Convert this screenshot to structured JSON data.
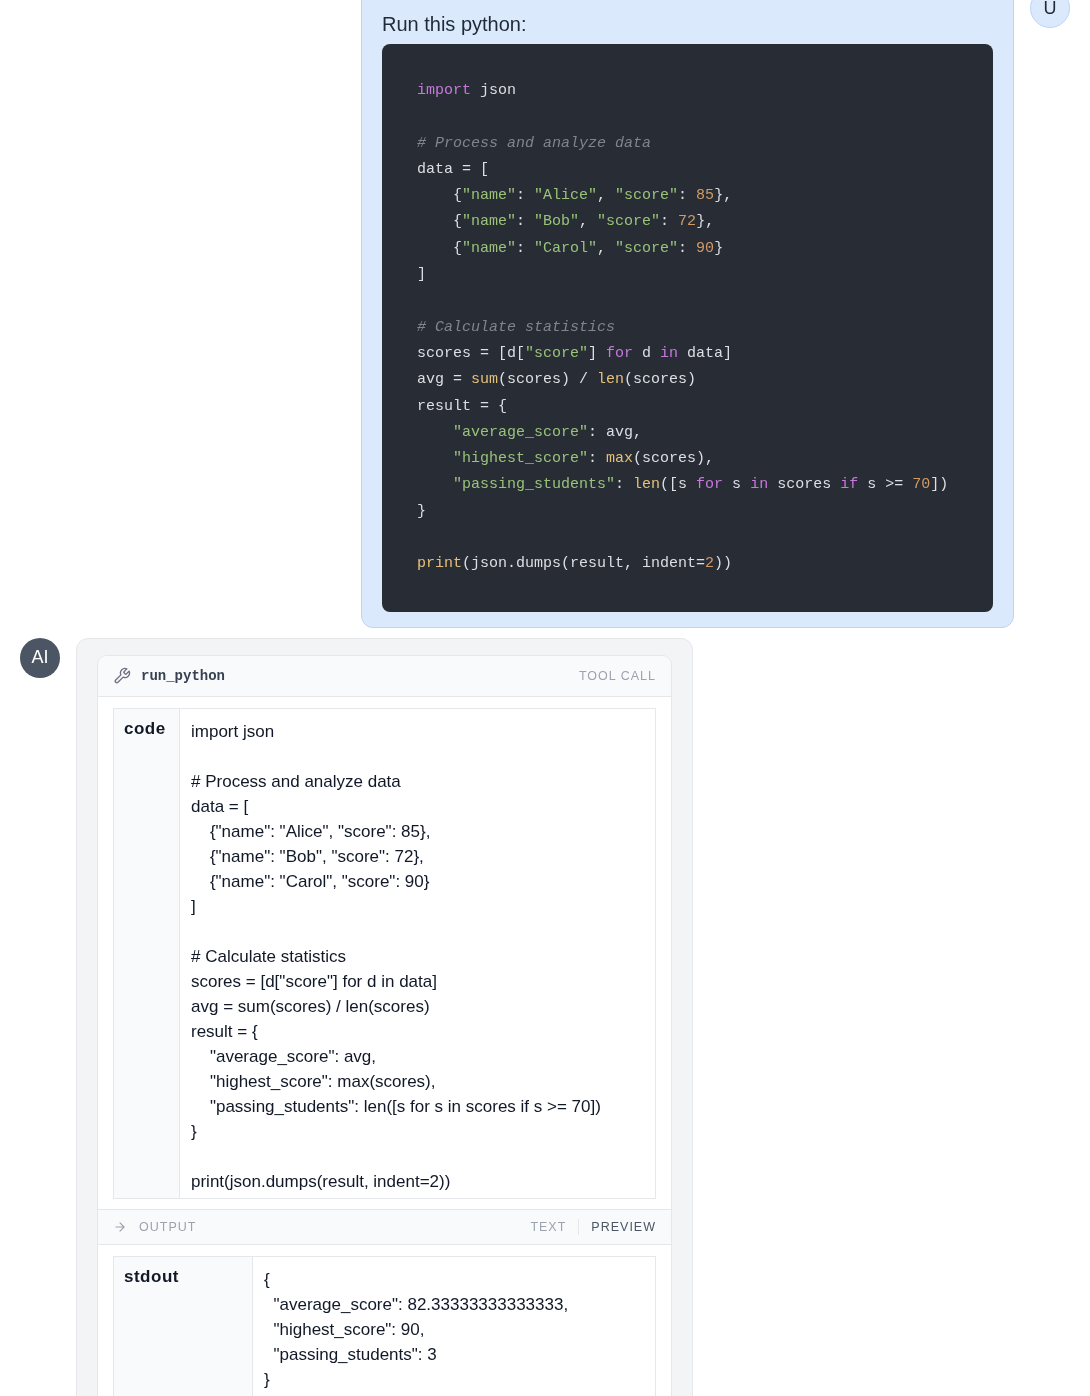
{
  "user_message": {
    "avatar": "U",
    "text": "Run this python:",
    "code_tokens": [
      {
        "kind": "keyword",
        "text": "import"
      },
      {
        "kind": "plain",
        "text": " json\n\n"
      },
      {
        "kind": "comment",
        "text": "# Process and analyze data"
      },
      {
        "kind": "plain",
        "text": "\ndata = [\n    {"
      },
      {
        "kind": "string",
        "text": "\"name\""
      },
      {
        "kind": "plain",
        "text": ": "
      },
      {
        "kind": "string",
        "text": "\"Alice\""
      },
      {
        "kind": "plain",
        "text": ", "
      },
      {
        "kind": "string",
        "text": "\"score\""
      },
      {
        "kind": "plain",
        "text": ": "
      },
      {
        "kind": "number",
        "text": "85"
      },
      {
        "kind": "plain",
        "text": "},\n    {"
      },
      {
        "kind": "string",
        "text": "\"name\""
      },
      {
        "kind": "plain",
        "text": ": "
      },
      {
        "kind": "string",
        "text": "\"Bob\""
      },
      {
        "kind": "plain",
        "text": ", "
      },
      {
        "kind": "string",
        "text": "\"score\""
      },
      {
        "kind": "plain",
        "text": ": "
      },
      {
        "kind": "number",
        "text": "72"
      },
      {
        "kind": "plain",
        "text": "},\n    {"
      },
      {
        "kind": "string",
        "text": "\"name\""
      },
      {
        "kind": "plain",
        "text": ": "
      },
      {
        "kind": "string",
        "text": "\"Carol\""
      },
      {
        "kind": "plain",
        "text": ", "
      },
      {
        "kind": "string",
        "text": "\"score\""
      },
      {
        "kind": "plain",
        "text": ": "
      },
      {
        "kind": "number",
        "text": "90"
      },
      {
        "kind": "plain",
        "text": "}\n]\n\n"
      },
      {
        "kind": "comment",
        "text": "# Calculate statistics"
      },
      {
        "kind": "plain",
        "text": "\nscores = [d["
      },
      {
        "kind": "string",
        "text": "\"score\""
      },
      {
        "kind": "plain",
        "text": "] "
      },
      {
        "kind": "keyword",
        "text": "for"
      },
      {
        "kind": "plain",
        "text": " d "
      },
      {
        "kind": "keyword",
        "text": "in"
      },
      {
        "kind": "plain",
        "text": " data]\navg = "
      },
      {
        "kind": "builtin",
        "text": "sum"
      },
      {
        "kind": "plain",
        "text": "(scores) / "
      },
      {
        "kind": "builtin",
        "text": "len"
      },
      {
        "kind": "plain",
        "text": "(scores)\nresult = {\n    "
      },
      {
        "kind": "string",
        "text": "\"average_score\""
      },
      {
        "kind": "plain",
        "text": ": avg,\n    "
      },
      {
        "kind": "string",
        "text": "\"highest_score\""
      },
      {
        "kind": "plain",
        "text": ": "
      },
      {
        "kind": "builtin",
        "text": "max"
      },
      {
        "kind": "plain",
        "text": "(scores),\n    "
      },
      {
        "kind": "string",
        "text": "\"passing_students\""
      },
      {
        "kind": "plain",
        "text": ": "
      },
      {
        "kind": "builtin",
        "text": "len"
      },
      {
        "kind": "plain",
        "text": "([s "
      },
      {
        "kind": "keyword",
        "text": "for"
      },
      {
        "kind": "plain",
        "text": " s "
      },
      {
        "kind": "keyword",
        "text": "in"
      },
      {
        "kind": "plain",
        "text": " scores "
      },
      {
        "kind": "keyword",
        "text": "if"
      },
      {
        "kind": "plain",
        "text": " s >= "
      },
      {
        "kind": "number",
        "text": "70"
      },
      {
        "kind": "plain",
        "text": "])\n}\n\n"
      },
      {
        "kind": "builtin",
        "text": "print"
      },
      {
        "kind": "plain",
        "text": "(json.dumps(result, indent="
      },
      {
        "kind": "number",
        "text": "2"
      },
      {
        "kind": "plain",
        "text": "))"
      }
    ]
  },
  "assistant_message": {
    "avatar": "AI",
    "tool_call": {
      "name": "run_python",
      "badge": "TOOL CALL",
      "arguments": [
        {
          "key": "code",
          "value": "import json\n\n# Process and analyze data\ndata = [\n    {\"name\": \"Alice\", \"score\": 85},\n    {\"name\": \"Bob\", \"score\": 72},\n    {\"name\": \"Carol\", \"score\": 90}\n]\n\n# Calculate statistics\nscores = [d[\"score\"] for d in data]\navg = sum(scores) / len(scores)\nresult = {\n    \"average_score\": avg,\n    \"highest_score\": max(scores),\n    \"passing_students\": len([s for s in scores if s >= 70])\n}\n\nprint(json.dumps(result, indent=2))"
        }
      ],
      "output": {
        "label": "OUTPUT",
        "tabs": [
          {
            "label": "TEXT",
            "selected": false
          },
          {
            "label": "PREVIEW",
            "selected": true
          }
        ],
        "fields": [
          {
            "key": "stdout",
            "value": "{\n  \"average_score\": 82.33333333333333,\n  \"highest_score\": 90,\n  \"passing_students\": 3\n}"
          }
        ]
      }
    }
  }
}
